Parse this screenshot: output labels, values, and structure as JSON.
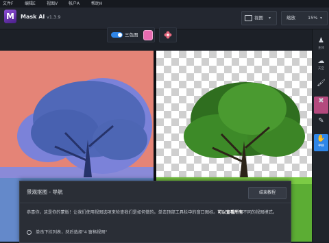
{
  "menu": {
    "file": "文件F",
    "edit": "编辑E",
    "view": "视图V",
    "account": "帐户A",
    "help": "帮助H"
  },
  "app": {
    "name": "Mask AI",
    "version": "v1.3.9",
    "logo_letter": "M"
  },
  "titlebar": {
    "view_label": "视图",
    "zoom_label": "缩放",
    "zoom_value": "15%"
  },
  "toolbar": {
    "trimap_label": "三色图",
    "trimap_on": true,
    "trimap_color": "#e56bb0"
  },
  "right_tools": [
    {
      "icon": "keep-icon",
      "label": "主体"
    },
    {
      "icon": "drop-icon",
      "label": "天空"
    },
    {
      "icon": "brush-icon",
      "label": ""
    },
    {
      "icon": "eraser-icon",
      "label": ""
    },
    {
      "icon": "pipette-icon",
      "label": ""
    },
    {
      "icon": "hand-icon",
      "label": "平移"
    }
  ],
  "dialog": {
    "title": "景观抠图 - 导航",
    "end_button": "结束教程",
    "body_text": "恭喜你，这是你的蒙版！让我们使用视图选项来检查我们是如何做的。单击顶部工具栏中的窗口图标。",
    "body_bold": "可以查看所有",
    "body_tail": "不同的视图模式。",
    "step_text": "单击下拉列表，然后选择\"4 窗格视图\""
  }
}
